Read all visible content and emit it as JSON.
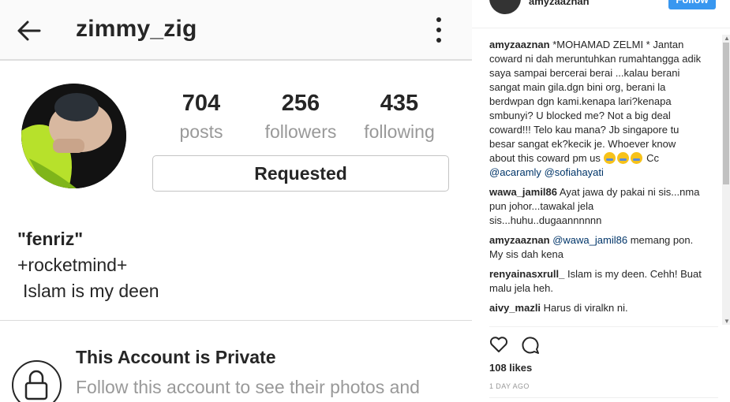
{
  "profile": {
    "username": "zimmy_zig",
    "stats": [
      {
        "value": "704",
        "label": "posts"
      },
      {
        "value": "256",
        "label": "followers"
      },
      {
        "value": "435",
        "label": "following"
      }
    ],
    "button_label": "Requested",
    "bio": {
      "name": "\"fenriz\"",
      "line2": "+rocketmind+",
      "line3": "Islam is my deen"
    },
    "private_title": "This Account is Private",
    "private_subtitle": "Follow this account to see their photos and"
  },
  "post": {
    "author": "amyzaaznan",
    "follow_label": "Follow",
    "comments": [
      {
        "user": "amyzaaznan",
        "text": "*MOHAMAD ZELMI * Jantan coward ni dah meruntuhkan rumahtangga adik saya sampai bercerai berai ...kalau berani sangat main gila.dgn bini org, berani la berdwpan dgn kami.kenapa lari?kenapa smbunyi? U blocked me? Not a big deal coward!!! Telo kau mana? Jb singapore tu besar sangat ek?kecik je. Whoever know about this coward pm us",
        "text_after": "Cc",
        "mention1": "@acaramly",
        "mention2": "@sofiahayati"
      },
      {
        "user": "wawa_jamil86",
        "text": "Ayat jawa dy pakai ni sis...nma pun johor...tawakal jela sis...huhu..dugaannnnnn"
      },
      {
        "user": "amyzaaznan",
        "mention": "@wawa_jamil86",
        "text": "memang pon. My sis dah kena"
      },
      {
        "user": "renyainasxrull_",
        "text": "Islam is my deen. Cehh! Buat malu jela heh."
      },
      {
        "user": "aivy_mazli",
        "text": "Harus di viralkn ni."
      }
    ],
    "likes": "108 likes",
    "time": "1 DAY AGO"
  },
  "colors": {
    "text": "#262626",
    "muted": "#999999",
    "link": "#003569",
    "follow_blue": "#3897f0"
  },
  "icons": [
    "back-arrow-icon",
    "more-vertical-icon",
    "lock-icon",
    "heart-icon",
    "comment-icon",
    "crying-laughing-emoji-icon"
  ]
}
